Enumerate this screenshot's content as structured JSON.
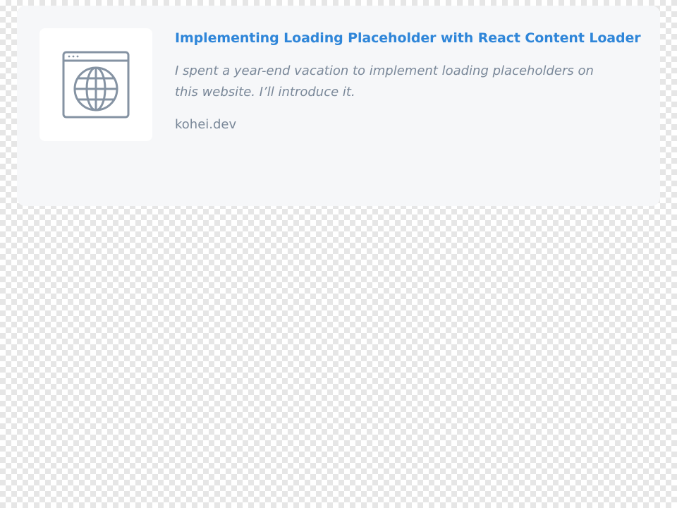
{
  "link_card": {
    "title": "Implementing Loading Placeholder with React Content Loader",
    "description": "I spent a year-end vacation to implement loading placeholders on this website. I’ll introduce it.",
    "domain": "kohei.dev",
    "thumbnail_icon": "globe-browser-icon"
  },
  "colors": {
    "card_background": "#f6f7f9",
    "title": "#2f86d9",
    "muted_text": "#7a8899",
    "icon_stroke": "#8593a3"
  }
}
